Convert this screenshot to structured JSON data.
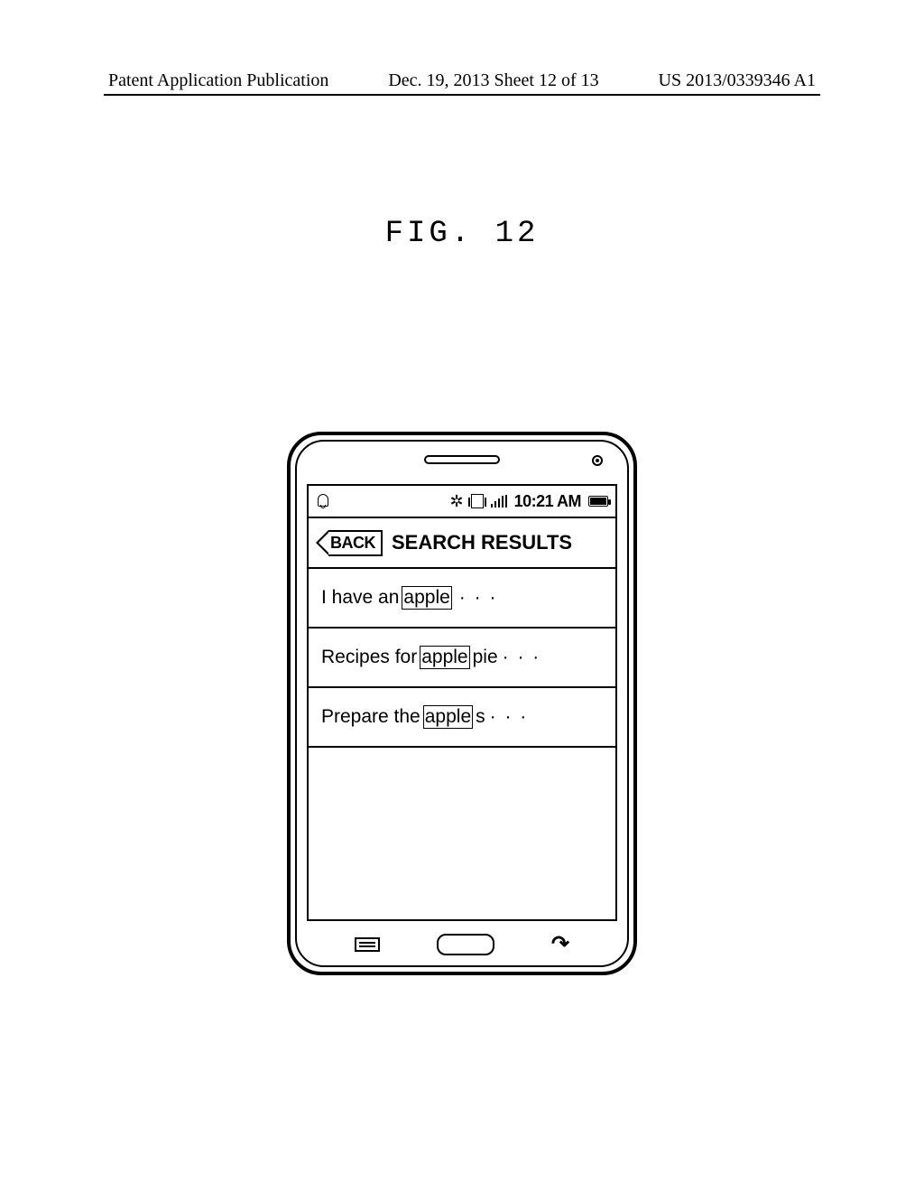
{
  "header": {
    "left": "Patent Application Publication",
    "center": "Dec. 19, 2013  Sheet 12 of 13",
    "right": "US 2013/0339346 A1"
  },
  "figure_label": "FIG. 12",
  "status": {
    "time": "10:21 AM"
  },
  "titlebar": {
    "back": "BACK",
    "title": "SEARCH RESULTS"
  },
  "results": [
    {
      "pre": "I have an",
      "hl": "apple",
      "post": "",
      "suffix": " · · ·"
    },
    {
      "pre": "Recipes for",
      "hl": "apple",
      "post": " pie",
      "suffix": " · · ·"
    },
    {
      "pre": "Prepare the",
      "hl": "apple",
      "post": "s",
      "suffix": " · · ·"
    }
  ]
}
